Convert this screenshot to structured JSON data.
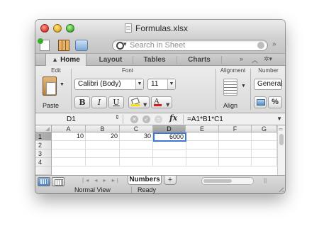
{
  "window": {
    "title": "Formulas.xlsx"
  },
  "search": {
    "placeholder": "Search in Sheet"
  },
  "tabs": [
    {
      "label": "Home",
      "active": true
    },
    {
      "label": "Layout",
      "active": false
    },
    {
      "label": "Tables",
      "active": false
    },
    {
      "label": "Charts",
      "active": false
    }
  ],
  "ribbon": {
    "groups": {
      "edit": "Edit",
      "font": "Font",
      "alignment": "Alignment",
      "number": "Number"
    },
    "paste_label": "Paste",
    "font_name": "Calibri (Body)",
    "font_size": "11",
    "bold": "B",
    "italic": "I",
    "underline": "U",
    "font_color_glyph": "A",
    "align_label": "Align",
    "number_format": "General",
    "percent": "%",
    "comma": ","
  },
  "formula_bar": {
    "cell_ref": "D1",
    "fx": "fx",
    "formula": "=A1*B1*C1"
  },
  "grid": {
    "columns": [
      "A",
      "B",
      "C",
      "D",
      "E",
      "F",
      "G"
    ],
    "selected_column": "D",
    "rows": [
      "1",
      "2",
      "3",
      "4"
    ],
    "selected_row": "1",
    "cells": {
      "A1": "10",
      "B1": "20",
      "C1": "30",
      "D1": "6000"
    }
  },
  "sheet_tabs": [
    {
      "label": "Numbers",
      "active": true
    }
  ],
  "add_sheet": "+",
  "status": {
    "view": "Normal View",
    "state": "Ready"
  },
  "colors": {
    "selection_border": "#3b78d4",
    "selected_header": "#a6a6a6"
  },
  "icons": [
    "new-workbook-icon",
    "templates-icon",
    "media-browser-icon",
    "search-icon",
    "paste-icon",
    "fill-color-icon",
    "font-color-icon",
    "align-icon",
    "number-format-icon",
    "fx-icon",
    "normal-view-icon",
    "page-layout-view-icon"
  ]
}
